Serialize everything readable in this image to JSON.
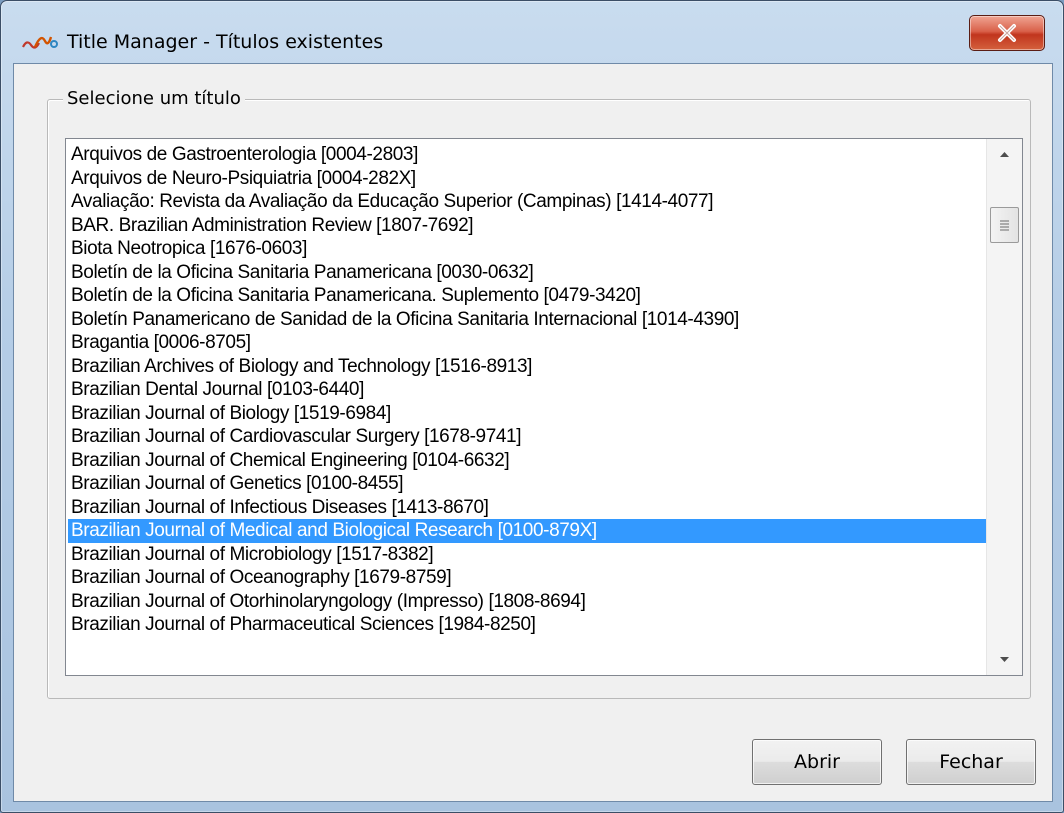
{
  "window": {
    "title": "Title Manager - Títulos existentes"
  },
  "group": {
    "label": "Selecione um título"
  },
  "list": {
    "items": [
      "Arquivos de Gastroenterologia [0004-2803]",
      "Arquivos de Neuro-Psiquiatria [0004-282X]",
      "Avaliação: Revista da Avaliação da Educação Superior (Campinas) [1414-4077]",
      "BAR. Brazilian Administration Review [1807-7692]",
      "Biota Neotropica [1676-0603]",
      "Boletín de la Oficina Sanitaria Panamericana [0030-0632]",
      "Boletín de la Oficina Sanitaria Panamericana. Suplemento [0479-3420]",
      "Boletín Panamericano de Sanidad de la Oficina Sanitaria Internacional [1014-4390]",
      "Bragantia [0006-8705]",
      "Brazilian Archives of Biology and Technology [1516-8913]",
      "Brazilian Dental Journal  [0103-6440]",
      "Brazilian Journal of Biology [1519-6984]",
      "Brazilian Journal of Cardiovascular Surgery [1678-9741]",
      "Brazilian Journal of Chemical Engineering [0104-6632]",
      "Brazilian Journal of Genetics [0100-8455]",
      "Brazilian Journal of Infectious Diseases [1413-8670]",
      "Brazilian Journal of Medical and Biological Research [0100-879X]",
      "Brazilian Journal of Microbiology [1517-8382]",
      "Brazilian Journal of Oceanography [1679-8759]",
      "Brazilian Journal of Otorhinolaryngology (Impresso) [1808-8694]",
      "Brazilian Journal of Pharmaceutical Sciences [1984-8250]"
    ],
    "selected_index": 16
  },
  "buttons": {
    "open_label": "Abrir",
    "close_label": "Fechar"
  },
  "colors": {
    "selection": "#3399ff",
    "close_button": "#c7432b"
  },
  "icons": {
    "app": "app-logo-icon",
    "close": "close-icon",
    "up": "scroll-up-icon",
    "down": "scroll-down-icon",
    "grip": "scroll-grip-icon"
  }
}
